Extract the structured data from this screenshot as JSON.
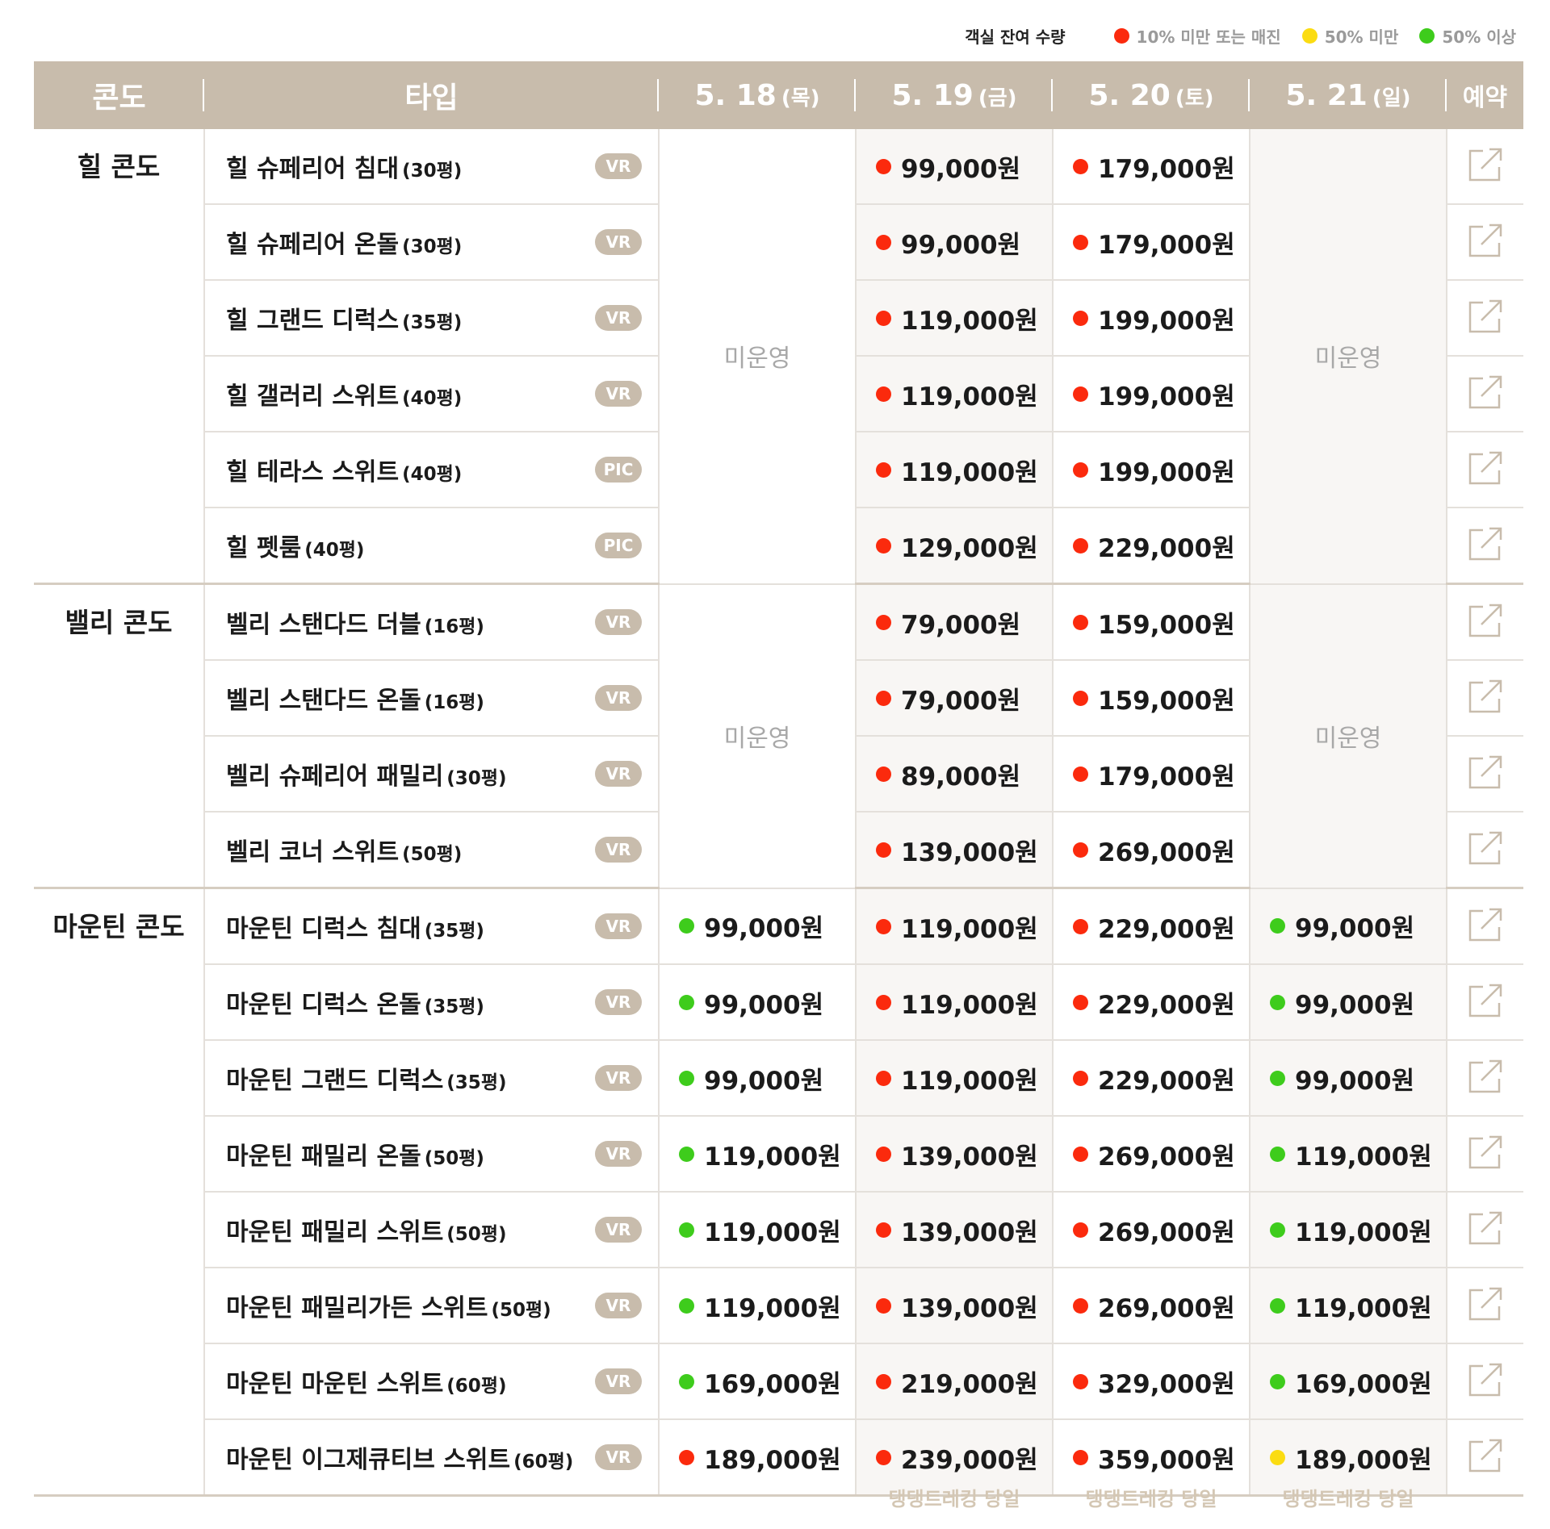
{
  "colors": {
    "red": "#fb2a0d",
    "yellow": "#fbdc12",
    "green": "#3ecc1c",
    "header": "#c8bcac"
  },
  "legend": {
    "title": "객실 잔여 수량",
    "items": [
      {
        "color": "#fb2a0d",
        "label": "10% 미만 또는 매진"
      },
      {
        "color": "#fbdc12",
        "label": "50% 미만"
      },
      {
        "color": "#3ecc1c",
        "label": "50% 이상"
      }
    ]
  },
  "header": {
    "condo": "콘도",
    "type": "타입",
    "dates": [
      {
        "date": "5. 18",
        "dow": "(목)"
      },
      {
        "date": "5. 19",
        "dow": "(금)"
      },
      {
        "date": "5. 20",
        "dow": "(토)"
      },
      {
        "date": "5. 21",
        "dow": "(일)"
      }
    ],
    "book": "예약"
  },
  "closed_label": "미운영",
  "groups": [
    {
      "condo": "힐 콘도",
      "closed_days": [
        0,
        3
      ],
      "rows": [
        {
          "name": "힐 슈페리어 침대",
          "size": "(30평)",
          "badge": "VR",
          "prices": [
            null,
            {
              "v": "99,000원",
              "c": "red"
            },
            {
              "v": "179,000원",
              "c": "red"
            },
            null
          ]
        },
        {
          "name": "힐 슈페리어 온돌",
          "size": "(30평)",
          "badge": "VR",
          "prices": [
            null,
            {
              "v": "99,000원",
              "c": "red"
            },
            {
              "v": "179,000원",
              "c": "red"
            },
            null
          ]
        },
        {
          "name": "힐 그랜드 디럭스",
          "size": "(35평)",
          "badge": "VR",
          "prices": [
            null,
            {
              "v": "119,000원",
              "c": "red"
            },
            {
              "v": "199,000원",
              "c": "red"
            },
            null
          ]
        },
        {
          "name": "힐 갤러리 스위트",
          "size": "(40평)",
          "badge": "VR",
          "prices": [
            null,
            {
              "v": "119,000원",
              "c": "red"
            },
            {
              "v": "199,000원",
              "c": "red"
            },
            null
          ]
        },
        {
          "name": "힐 테라스 스위트",
          "size": "(40평)",
          "badge": "PIC",
          "prices": [
            null,
            {
              "v": "119,000원",
              "c": "red"
            },
            {
              "v": "199,000원",
              "c": "red"
            },
            null
          ]
        },
        {
          "name": "힐 펫룸",
          "size": "(40평)",
          "badge": "PIC",
          "prices": [
            null,
            {
              "v": "129,000원",
              "c": "red"
            },
            {
              "v": "229,000원",
              "c": "red"
            },
            null
          ]
        }
      ]
    },
    {
      "condo": "밸리 콘도",
      "closed_days": [
        0,
        3
      ],
      "rows": [
        {
          "name": "벨리 스탠다드 더블",
          "size": "(16평)",
          "badge": "VR",
          "prices": [
            null,
            {
              "v": "79,000원",
              "c": "red"
            },
            {
              "v": "159,000원",
              "c": "red"
            },
            null
          ]
        },
        {
          "name": "벨리 스탠다드 온돌",
          "size": "(16평)",
          "badge": "VR",
          "prices": [
            null,
            {
              "v": "79,000원",
              "c": "red"
            },
            {
              "v": "159,000원",
              "c": "red"
            },
            null
          ]
        },
        {
          "name": "벨리 슈페리어 패밀리",
          "size": "(30평)",
          "badge": "VR",
          "prices": [
            null,
            {
              "v": "89,000원",
              "c": "red"
            },
            {
              "v": "179,000원",
              "c": "red"
            },
            null
          ]
        },
        {
          "name": "벨리 코너 스위트",
          "size": "(50평)",
          "badge": "VR",
          "prices": [
            null,
            {
              "v": "139,000원",
              "c": "red"
            },
            {
              "v": "269,000원",
              "c": "red"
            },
            null
          ]
        }
      ]
    },
    {
      "condo": "마운틴 콘도",
      "closed_days": [],
      "rows": [
        {
          "name": "마운틴 디럭스 침대",
          "size": "(35평)",
          "badge": "VR",
          "prices": [
            {
              "v": "99,000원",
              "c": "green"
            },
            {
              "v": "119,000원",
              "c": "red"
            },
            {
              "v": "229,000원",
              "c": "red"
            },
            {
              "v": "99,000원",
              "c": "green"
            }
          ]
        },
        {
          "name": "마운틴 디럭스 온돌",
          "size": "(35평)",
          "badge": "VR",
          "prices": [
            {
              "v": "99,000원",
              "c": "green"
            },
            {
              "v": "119,000원",
              "c": "red"
            },
            {
              "v": "229,000원",
              "c": "red"
            },
            {
              "v": "99,000원",
              "c": "green"
            }
          ]
        },
        {
          "name": "마운틴 그랜드 디럭스",
          "size": "(35평)",
          "badge": "VR",
          "prices": [
            {
              "v": "99,000원",
              "c": "green"
            },
            {
              "v": "119,000원",
              "c": "red"
            },
            {
              "v": "229,000원",
              "c": "red"
            },
            {
              "v": "99,000원",
              "c": "green"
            }
          ]
        },
        {
          "name": "마운틴 패밀리 온돌",
          "size": "(50평)",
          "badge": "VR",
          "prices": [
            {
              "v": "119,000원",
              "c": "green"
            },
            {
              "v": "139,000원",
              "c": "red"
            },
            {
              "v": "269,000원",
              "c": "red"
            },
            {
              "v": "119,000원",
              "c": "green"
            }
          ]
        },
        {
          "name": "마운틴 패밀리 스위트",
          "size": "(50평)",
          "badge": "VR",
          "prices": [
            {
              "v": "119,000원",
              "c": "green"
            },
            {
              "v": "139,000원",
              "c": "red"
            },
            {
              "v": "269,000원",
              "c": "red"
            },
            {
              "v": "119,000원",
              "c": "green"
            }
          ]
        },
        {
          "name": "마운틴 패밀리가든 스위트",
          "size": "(50평)",
          "badge": "VR",
          "prices": [
            {
              "v": "119,000원",
              "c": "green"
            },
            {
              "v": "139,000원",
              "c": "red"
            },
            {
              "v": "269,000원",
              "c": "red"
            },
            {
              "v": "119,000원",
              "c": "green"
            }
          ]
        },
        {
          "name": "마운틴 마운틴 스위트",
          "size": "(60평)",
          "badge": "VR",
          "prices": [
            {
              "v": "169,000원",
              "c": "green"
            },
            {
              "v": "219,000원",
              "c": "red"
            },
            {
              "v": "329,000원",
              "c": "red"
            },
            {
              "v": "169,000원",
              "c": "green"
            }
          ]
        },
        {
          "name": "마운틴 이그제큐티브 스위트",
          "size": "(60평)",
          "badge": "VR",
          "prices": [
            {
              "v": "189,000원",
              "c": "red"
            },
            {
              "v": "239,000원",
              "c": "red"
            },
            {
              "v": "359,000원",
              "c": "red"
            },
            {
              "v": "189,000원",
              "c": "yellow"
            }
          ]
        }
      ]
    }
  ],
  "footer_notes": [
    {
      "day": 1,
      "text": "댕댕트레킹 당일"
    },
    {
      "day": 2,
      "text": "댕댕트레킹 당일"
    },
    {
      "day": 3,
      "text": "댕댕트레킹 당일"
    }
  ]
}
